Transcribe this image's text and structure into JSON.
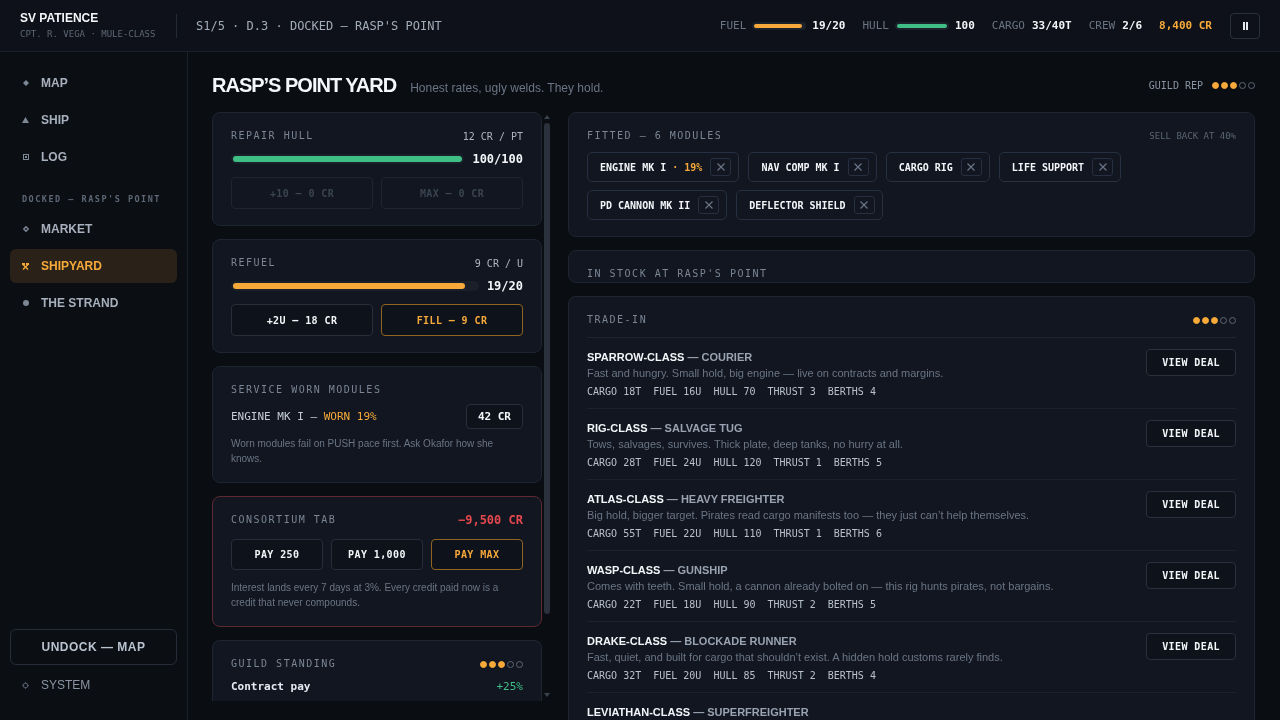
{
  "topbar": {
    "ship_name": "SV PATIENCE",
    "ship_subtitle": "CPT. R. VEGA · MULE-CLASS",
    "location": "S1/5 · D.3 · DOCKED — RASP'S POINT",
    "gauges": [
      {
        "label": "FUEL",
        "level": 0.95,
        "reading": "19/20",
        "color": "#f7a93a"
      },
      {
        "label": "HULL",
        "level": 1,
        "reading": "100",
        "color": "#3fbf86"
      }
    ],
    "stats": [
      {
        "label": "CARGO",
        "value": "33/40T"
      },
      {
        "label": "CREW",
        "value": "2/6"
      }
    ],
    "credits": "8,400 CR"
  },
  "sidebar": {
    "nav": [
      {
        "label": "MAP",
        "selected": false
      },
      {
        "label": "SHIP",
        "selected": false
      },
      {
        "label": "LOG",
        "selected": false
      }
    ],
    "section_label": "DOCKED — RASP'S POINT",
    "station": [
      {
        "label": "MARKET",
        "selected": false
      },
      {
        "label": "SHIPYARD",
        "selected": true
      },
      {
        "label": "THE STRAND",
        "selected": false
      }
    ],
    "undock_button": "UNDOCK — MAP",
    "system_item": "SYSTEM"
  },
  "page": {
    "title": "RASP’S POINT YARD",
    "subtitle": "Honest rates, ugly welds. They hold.",
    "guild_rep": {
      "label": "GUILD REP",
      "stars": 3
    }
  },
  "services": [
    {
      "kind": "meter",
      "title": "REPAIR HULL",
      "rate": "12 CR / PT",
      "level": 1,
      "reading": "100/100",
      "color": "#3fbf86",
      "buttons": [
        {
          "label": "+10 — 0 CR",
          "disabled": true,
          "primary": false
        },
        {
          "label": "MAX — 0 CR",
          "disabled": true,
          "primary": false
        }
      ]
    },
    {
      "kind": "meter",
      "title": "REFUEL",
      "rate": "9 CR / U",
      "level": 0.95,
      "reading": "19/20",
      "color": "#f7a93a",
      "buttons": [
        {
          "label": "+2U — 18 CR",
          "disabled": false,
          "primary": false
        },
        {
          "label": "FILL — 9 CR",
          "disabled": false,
          "primary": true
        }
      ]
    },
    {
      "kind": "service",
      "title": "SERVICE WORN MODULES",
      "module": "ENGINE MK I —",
      "wear": "WORN 19%",
      "price": "42 CR",
      "note": "Worn modules fail on PUSH pace first. Ask Okafor how she knows."
    },
    {
      "kind": "debt",
      "title": "CONSORTIUM TAB",
      "amount": "−9,500 CR",
      "buttons": [
        {
          "label": "PAY 250",
          "disabled": false,
          "primary": false
        },
        {
          "label": "PAY 1,000",
          "disabled": false,
          "primary": false
        },
        {
          "label": "PAY MAX",
          "disabled": false,
          "primary": true
        }
      ],
      "note": "Interest lands every 7 days at 3%. Every credit paid now is a credit that never compounds."
    },
    {
      "kind": "standing",
      "title": "GUILD STANDING",
      "stars": 3,
      "perks": [
        {
          "label": "Contract pay",
          "value": "+25%"
        }
      ]
    }
  ],
  "fitted": {
    "title": "FITTED — 6 MODULES",
    "note": "SELL BACK AT 40%",
    "modules": [
      {
        "name": "ENGINE MK I",
        "wear": "· 19%"
      },
      {
        "name": "NAV COMP MK I"
      },
      {
        "name": "CARGO RIG"
      },
      {
        "name": "LIFE SUPPORT"
      },
      {
        "name": "PD CANNON MK II"
      },
      {
        "name": "DEFLECTOR SHIELD"
      }
    ]
  },
  "in_stock": {
    "title": "IN STOCK AT RASP'S POINT"
  },
  "trade_in": {
    "title": "TRADE-IN",
    "stars": 3,
    "ships": [
      {
        "name": "SPARROW-CLASS",
        "role": "— COURIER",
        "description": "Fast and hungry. Small hold, big engine — live on contracts and margins.",
        "specs": [
          {
            "label": "CARGO",
            "value": "18T"
          },
          {
            "label": "FUEL",
            "value": "16U"
          },
          {
            "label": "HULL",
            "value": "70"
          },
          {
            "label": "THRUST",
            "value": "3"
          },
          {
            "label": "BERTHS",
            "value": "4"
          }
        ],
        "action": "VIEW DEAL"
      },
      {
        "name": "RIG-CLASS",
        "role": "— SALVAGE TUG",
        "description": "Tows, salvages, survives. Thick plate, deep tanks, no hurry at all.",
        "specs": [
          {
            "label": "CARGO",
            "value": "28T"
          },
          {
            "label": "FUEL",
            "value": "24U"
          },
          {
            "label": "HULL",
            "value": "120"
          },
          {
            "label": "THRUST",
            "value": "1"
          },
          {
            "label": "BERTHS",
            "value": "5"
          }
        ],
        "action": "VIEW DEAL"
      },
      {
        "name": "ATLAS-CLASS",
        "role": "— HEAVY FREIGHTER",
        "description": "Big hold, bigger target. Pirates read cargo manifests too — they just can’t help themselves.",
        "specs": [
          {
            "label": "CARGO",
            "value": "55T"
          },
          {
            "label": "FUEL",
            "value": "22U"
          },
          {
            "label": "HULL",
            "value": "110"
          },
          {
            "label": "THRUST",
            "value": "1"
          },
          {
            "label": "BERTHS",
            "value": "6"
          }
        ],
        "action": "VIEW DEAL"
      },
      {
        "name": "WASP-CLASS",
        "role": "— GUNSHIP",
        "description": "Comes with teeth. Small hold, a cannon already bolted on — this rig hunts pirates, not bargains.",
        "specs": [
          {
            "label": "CARGO",
            "value": "22T"
          },
          {
            "label": "FUEL",
            "value": "18U"
          },
          {
            "label": "HULL",
            "value": "90"
          },
          {
            "label": "THRUST",
            "value": "2"
          },
          {
            "label": "BERTHS",
            "value": "5"
          }
        ],
        "action": "VIEW DEAL"
      },
      {
        "name": "DRAKE-CLASS",
        "role": "— BLOCKADE RUNNER",
        "description": "Fast, quiet, and built for cargo that shouldn’t exist. A hidden hold customs rarely finds.",
        "specs": [
          {
            "label": "CARGO",
            "value": "32T"
          },
          {
            "label": "FUEL",
            "value": "20U"
          },
          {
            "label": "HULL",
            "value": "85"
          },
          {
            "label": "THRUST",
            "value": "2"
          },
          {
            "label": "BERTHS",
            "value": "4"
          }
        ],
        "action": "VIEW DEAL"
      },
      {
        "name": "LEVIATHAN-CLASS",
        "role": "— SUPERFREIGHTER"
      }
    ]
  }
}
